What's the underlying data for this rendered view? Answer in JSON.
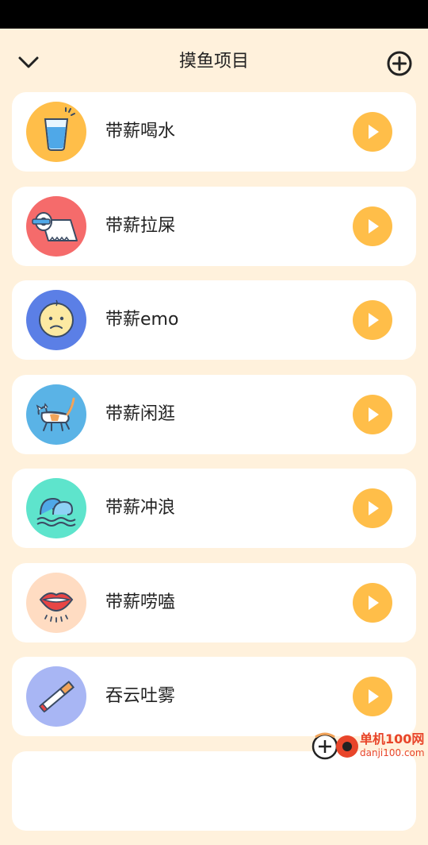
{
  "header": {
    "title": "摸鱼项目"
  },
  "items": [
    {
      "label": "带薪喝水",
      "icon": "water-glass-icon",
      "bg": "#FFBE49"
    },
    {
      "label": "带薪拉屎",
      "icon": "toilet-paper-icon",
      "bg": "#F56B6B"
    },
    {
      "label": "带薪emo",
      "icon": "sad-face-icon",
      "bg": "#5B7FE6"
    },
    {
      "label": "带薪闲逛",
      "icon": "cat-icon",
      "bg": "#5AB3E6"
    },
    {
      "label": "带薪冲浪",
      "icon": "wave-icon",
      "bg": "#5EE4CC"
    },
    {
      "label": "带薪唠嗑",
      "icon": "mouth-icon",
      "bg": "#FFDCC2"
    },
    {
      "label": "吞云吐雾",
      "icon": "cigarette-icon",
      "bg": "#A8B6F4"
    }
  ],
  "watermark": {
    "title": "单机100网",
    "url": "danji100.com"
  }
}
